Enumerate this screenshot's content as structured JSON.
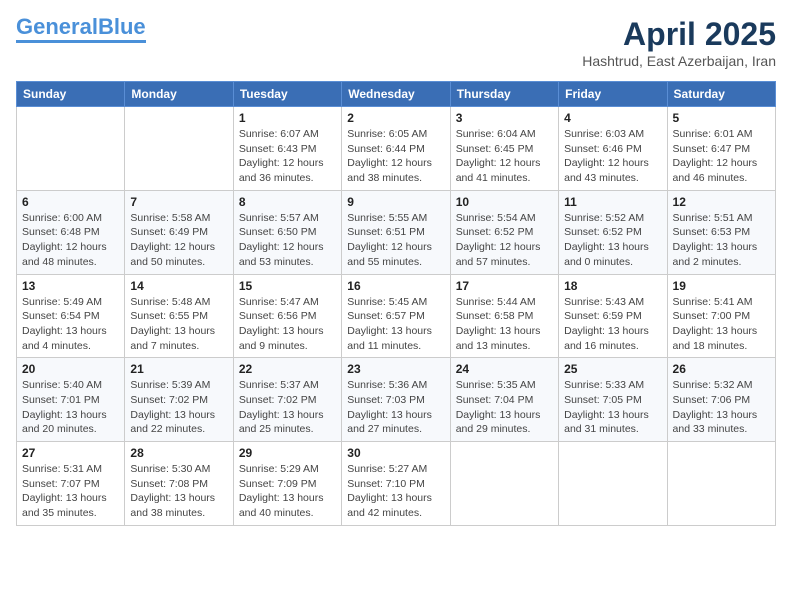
{
  "header": {
    "logo_general": "General",
    "logo_blue": "Blue",
    "month": "April 2025",
    "location": "Hashtrud, East Azerbaijan, Iran"
  },
  "days_of_week": [
    "Sunday",
    "Monday",
    "Tuesday",
    "Wednesday",
    "Thursday",
    "Friday",
    "Saturday"
  ],
  "weeks": [
    [
      {
        "day": "",
        "info": ""
      },
      {
        "day": "",
        "info": ""
      },
      {
        "day": "1",
        "info": "Sunrise: 6:07 AM\nSunset: 6:43 PM\nDaylight: 12 hours and 36 minutes."
      },
      {
        "day": "2",
        "info": "Sunrise: 6:05 AM\nSunset: 6:44 PM\nDaylight: 12 hours and 38 minutes."
      },
      {
        "day": "3",
        "info": "Sunrise: 6:04 AM\nSunset: 6:45 PM\nDaylight: 12 hours and 41 minutes."
      },
      {
        "day": "4",
        "info": "Sunrise: 6:03 AM\nSunset: 6:46 PM\nDaylight: 12 hours and 43 minutes."
      },
      {
        "day": "5",
        "info": "Sunrise: 6:01 AM\nSunset: 6:47 PM\nDaylight: 12 hours and 46 minutes."
      }
    ],
    [
      {
        "day": "6",
        "info": "Sunrise: 6:00 AM\nSunset: 6:48 PM\nDaylight: 12 hours and 48 minutes."
      },
      {
        "day": "7",
        "info": "Sunrise: 5:58 AM\nSunset: 6:49 PM\nDaylight: 12 hours and 50 minutes."
      },
      {
        "day": "8",
        "info": "Sunrise: 5:57 AM\nSunset: 6:50 PM\nDaylight: 12 hours and 53 minutes."
      },
      {
        "day": "9",
        "info": "Sunrise: 5:55 AM\nSunset: 6:51 PM\nDaylight: 12 hours and 55 minutes."
      },
      {
        "day": "10",
        "info": "Sunrise: 5:54 AM\nSunset: 6:52 PM\nDaylight: 12 hours and 57 minutes."
      },
      {
        "day": "11",
        "info": "Sunrise: 5:52 AM\nSunset: 6:52 PM\nDaylight: 13 hours and 0 minutes."
      },
      {
        "day": "12",
        "info": "Sunrise: 5:51 AM\nSunset: 6:53 PM\nDaylight: 13 hours and 2 minutes."
      }
    ],
    [
      {
        "day": "13",
        "info": "Sunrise: 5:49 AM\nSunset: 6:54 PM\nDaylight: 13 hours and 4 minutes."
      },
      {
        "day": "14",
        "info": "Sunrise: 5:48 AM\nSunset: 6:55 PM\nDaylight: 13 hours and 7 minutes."
      },
      {
        "day": "15",
        "info": "Sunrise: 5:47 AM\nSunset: 6:56 PM\nDaylight: 13 hours and 9 minutes."
      },
      {
        "day": "16",
        "info": "Sunrise: 5:45 AM\nSunset: 6:57 PM\nDaylight: 13 hours and 11 minutes."
      },
      {
        "day": "17",
        "info": "Sunrise: 5:44 AM\nSunset: 6:58 PM\nDaylight: 13 hours and 13 minutes."
      },
      {
        "day": "18",
        "info": "Sunrise: 5:43 AM\nSunset: 6:59 PM\nDaylight: 13 hours and 16 minutes."
      },
      {
        "day": "19",
        "info": "Sunrise: 5:41 AM\nSunset: 7:00 PM\nDaylight: 13 hours and 18 minutes."
      }
    ],
    [
      {
        "day": "20",
        "info": "Sunrise: 5:40 AM\nSunset: 7:01 PM\nDaylight: 13 hours and 20 minutes."
      },
      {
        "day": "21",
        "info": "Sunrise: 5:39 AM\nSunset: 7:02 PM\nDaylight: 13 hours and 22 minutes."
      },
      {
        "day": "22",
        "info": "Sunrise: 5:37 AM\nSunset: 7:02 PM\nDaylight: 13 hours and 25 minutes."
      },
      {
        "day": "23",
        "info": "Sunrise: 5:36 AM\nSunset: 7:03 PM\nDaylight: 13 hours and 27 minutes."
      },
      {
        "day": "24",
        "info": "Sunrise: 5:35 AM\nSunset: 7:04 PM\nDaylight: 13 hours and 29 minutes."
      },
      {
        "day": "25",
        "info": "Sunrise: 5:33 AM\nSunset: 7:05 PM\nDaylight: 13 hours and 31 minutes."
      },
      {
        "day": "26",
        "info": "Sunrise: 5:32 AM\nSunset: 7:06 PM\nDaylight: 13 hours and 33 minutes."
      }
    ],
    [
      {
        "day": "27",
        "info": "Sunrise: 5:31 AM\nSunset: 7:07 PM\nDaylight: 13 hours and 35 minutes."
      },
      {
        "day": "28",
        "info": "Sunrise: 5:30 AM\nSunset: 7:08 PM\nDaylight: 13 hours and 38 minutes."
      },
      {
        "day": "29",
        "info": "Sunrise: 5:29 AM\nSunset: 7:09 PM\nDaylight: 13 hours and 40 minutes."
      },
      {
        "day": "30",
        "info": "Sunrise: 5:27 AM\nSunset: 7:10 PM\nDaylight: 13 hours and 42 minutes."
      },
      {
        "day": "",
        "info": ""
      },
      {
        "day": "",
        "info": ""
      },
      {
        "day": "",
        "info": ""
      }
    ]
  ]
}
